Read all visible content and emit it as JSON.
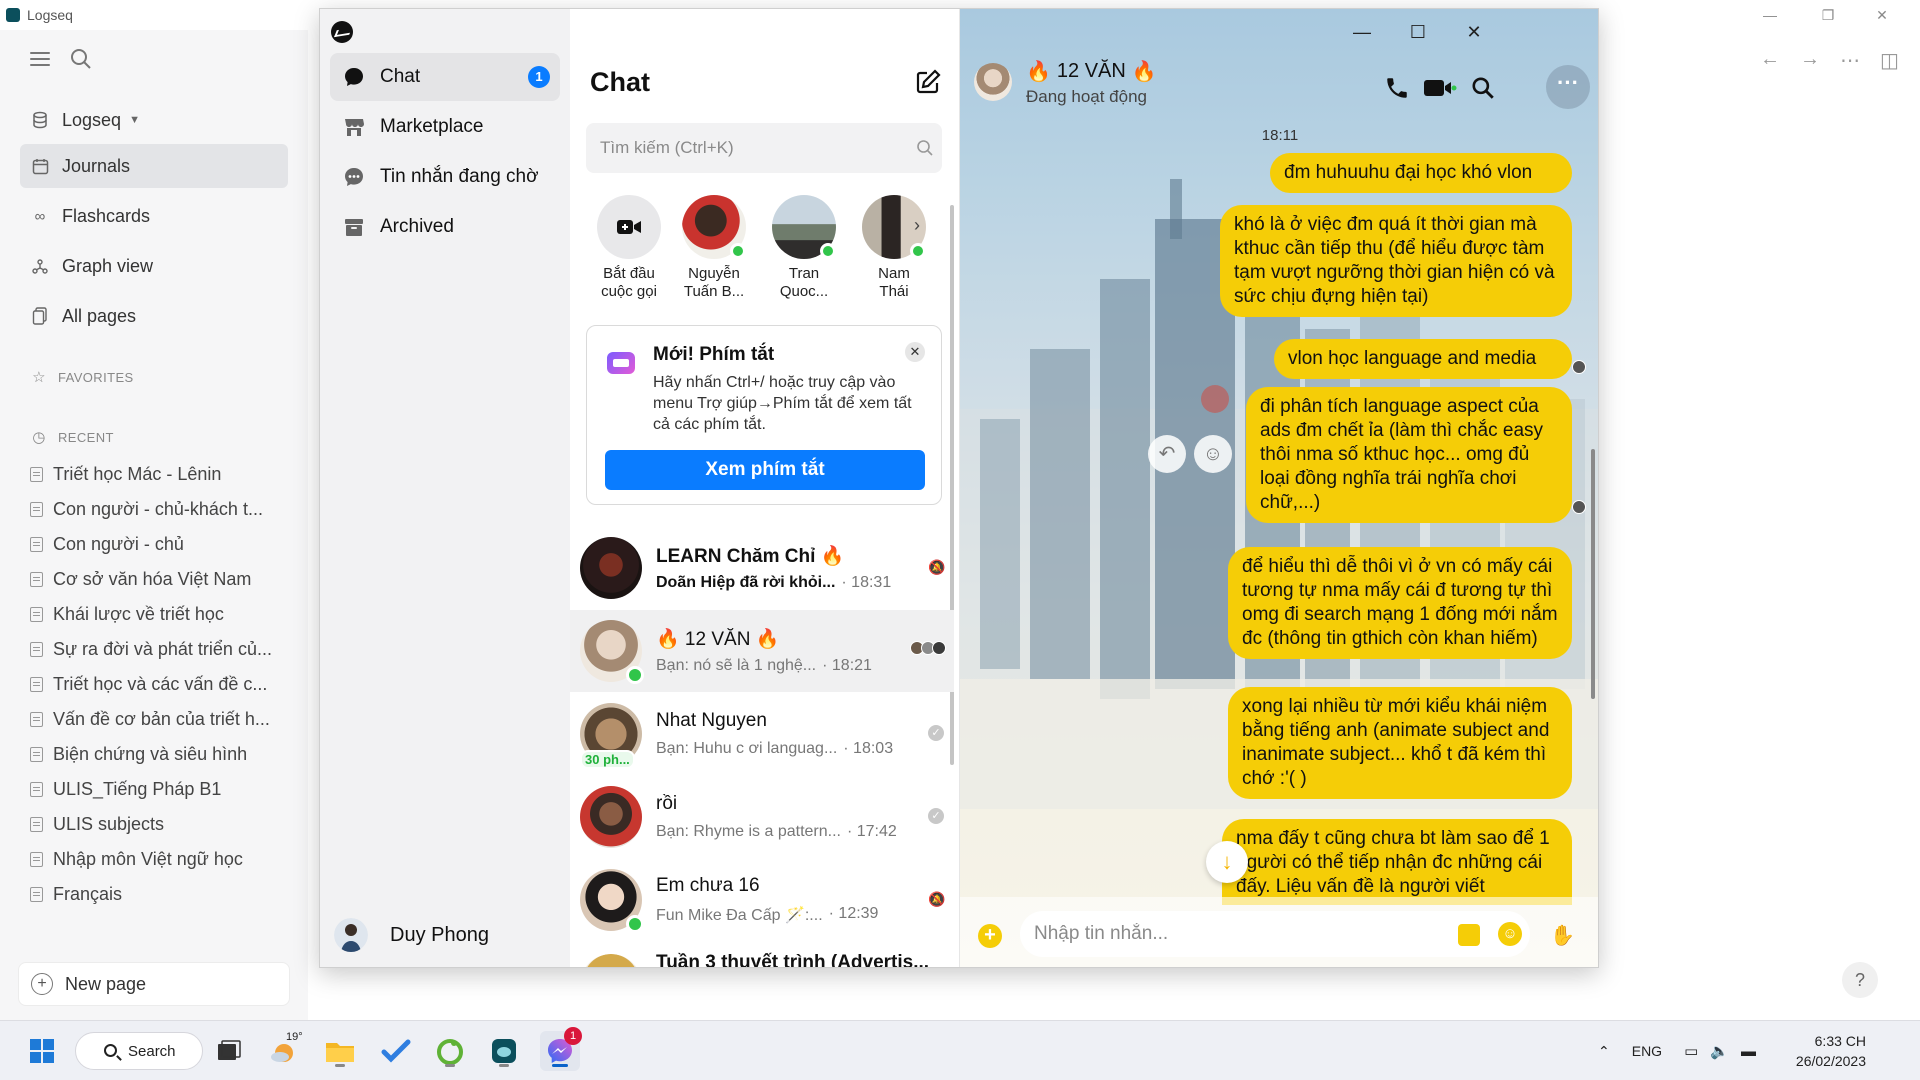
{
  "logseq": {
    "app_title": "Logseq",
    "graph_name": "Logseq",
    "nav": [
      {
        "label": "Journals",
        "icon": "calendar-icon"
      },
      {
        "label": "Flashcards",
        "icon": "infinity-icon"
      },
      {
        "label": "Graph view",
        "icon": "graph-icon"
      },
      {
        "label": "All pages",
        "icon": "pages-icon"
      }
    ],
    "favorites_label": "FAVORITES",
    "recent_label": "RECENT",
    "recent": [
      "Triết học Mác - Lênin",
      "Con người - chủ-khách t...",
      "Con người - chủ",
      "Cơ sở văn hóa Việt Nam",
      "Khái lược về triết học",
      "Sự ra đời và phát triển củ...",
      "Triết học và các vấn đề c...",
      "Vấn đề cơ bản của triết h...",
      "Biện chứng và siêu hình",
      "ULIS_Tiếng Pháp B1",
      "ULIS subjects",
      "Nhập môn Việt ngữ học",
      "Français"
    ],
    "new_page_label": "New page",
    "help_label": "?"
  },
  "messenger": {
    "nav": {
      "items": [
        {
          "label": "Chat",
          "badge": "1"
        },
        {
          "label": "Marketplace"
        },
        {
          "label": "Tin nhắn đang chờ"
        },
        {
          "label": "Archived"
        }
      ],
      "profile_name": "Duy Phong"
    },
    "list": {
      "title": "Chat",
      "search_placeholder": "Tìm kiếm (Ctrl+K)",
      "stories": [
        {
          "line1": "Bắt đầu",
          "line2": "cuộc gọi"
        },
        {
          "line1": "Nguyễn",
          "line2": "Tuấn B..."
        },
        {
          "line1": "Tran",
          "line2": "Quoc..."
        },
        {
          "line1": "Nam",
          "line2": "Thái"
        }
      ],
      "tip": {
        "title": "Mới! Phím tắt",
        "body": "Hãy nhấn Ctrl+/ hoặc truy cập vào menu Trợ giúp→Phím tắt để xem tất cả các phím tắt.",
        "button": "Xem phím tắt",
        "close": "✕"
      },
      "conversations": [
        {
          "name": "LEARN Chăm Chỉ 🔥",
          "snippet": "Doãn Hiệp đã rời khỏi...",
          "time": "· 18:31"
        },
        {
          "name": "🔥 12 VĂN 🔥",
          "snippet": "Bạn: nó sẽ là 1 nghệ...",
          "time": "· 18:21"
        },
        {
          "name": "Nhat Nguyen",
          "snippet": "Bạn: Huhu c ơi languag...",
          "time": "· 18:03",
          "active_tag": "30 ph..."
        },
        {
          "name": "rồi",
          "snippet": "Bạn: Rhyme is a pattern...",
          "time": "· 17:42"
        },
        {
          "name": "Em chưa 16",
          "snippet": "Fun Mike Đa Cấp 🪄:...",
          "time": "· 12:39"
        },
        {
          "name": "Tuần 3 thuyết trình (Advertis..."
        }
      ]
    },
    "conversation": {
      "name": "12 VĂN",
      "status": "Đang hoạt động",
      "timestamp": "18:11",
      "messages": [
        "đm huhuuhu đại học khó vlon",
        "khó là ở việc đm quá ít thời gian mà kthuc cần tiếp thu (để hiểu được tàm tạm vượt ngưỡng thời gian hiện có và sức chịu đựng hiện tại)",
        "vlon học language and media",
        "đi phân tích language aspect của ads đm chết ỉa (làm thì chắc easy thôi nma số kthuc học... omg đủ loại đồng nghĩa trái nghĩa chơi chữ,...)",
        "để hiểu thì dễ thôi vì ở vn có mấy cái tương tự nma mấy cái đ tương tự thì omg đi search mạng 1 đống mới nắm đc (thông tin gthich còn khan hiếm)",
        "xong lại nhiều từ mới kiểu khái niệm bằng tiếng anh (animate subject and inanimate subject... khổ t đã kém thì chớ :'( )",
        "nma đấy t cũng chưa bt làm sao để 1 người có thể tiếp nhận đc những cái đấy. Liệu vấn đề là người viết"
      ],
      "composer_placeholder": "Nhập tin nhắn..."
    }
  },
  "taskbar": {
    "search_label": "Search",
    "weather_temp": "19°",
    "messenger_badge": "1",
    "language": "ENG",
    "time": "6:33 CH",
    "date": "26/02/2023"
  },
  "colors": {
    "messenger_blue": "#0a7cff",
    "bubble_yellow": "#f5cd07",
    "online_green": "#31c54a"
  }
}
